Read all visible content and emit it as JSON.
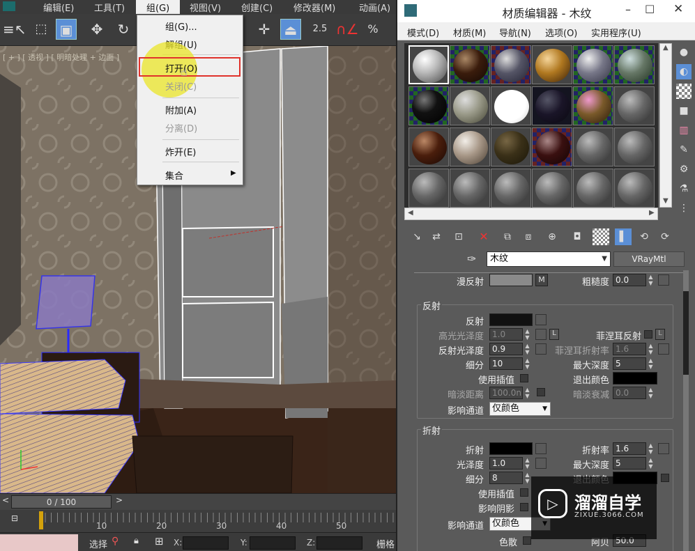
{
  "left_menu": [
    "编辑(E)",
    "工具(T)",
    "组(G)",
    "视图(V)",
    "创建(C)",
    "修改器(M)",
    "动画(A)"
  ],
  "toolbar": {
    "snap_label": "2.5",
    "percent_label": "%"
  },
  "viewport": {
    "label": "[ + ] [ 透视 ] [ 明暗处理 + 边面 ]"
  },
  "dropdown": {
    "items": [
      {
        "label": "组(G)...",
        "enabled": true
      },
      {
        "label": "解组(U)",
        "enabled": true
      },
      {
        "label": "打开(O)",
        "enabled": true,
        "highlighted": true
      },
      {
        "label": "关闭(C)",
        "enabled": false
      },
      {
        "label": "附加(A)",
        "enabled": true
      },
      {
        "label": "分离(D)",
        "enabled": false
      },
      {
        "label": "炸开(E)",
        "enabled": true
      },
      {
        "label": "集合",
        "enabled": true,
        "submenu": true
      }
    ]
  },
  "timeline": {
    "frame": "0 / 100",
    "ticks": [
      "10",
      "20",
      "30",
      "40",
      "50"
    ]
  },
  "statusbar": {
    "select_label": "选择",
    "x_label": "X:",
    "y_label": "Y:",
    "z_label": "Z:",
    "grid_label": "栅格"
  },
  "material_editor": {
    "title": "材质编辑器 - 木纹",
    "menu": [
      "模式(D)",
      "材质(M)",
      "导航(N)",
      "选项(O)",
      "实用程序(U)"
    ],
    "material_name": "木纹",
    "material_type": "VRayMtl",
    "diffuse": {
      "label": "漫反射",
      "map_btn": "M",
      "roughness_label": "粗糙度",
      "roughness": "0.0"
    },
    "reflection": {
      "group_title": "反射",
      "reflect_label": "反射",
      "hilight_gloss_label": "高光光泽度",
      "hilight_gloss": "1.0",
      "lock_btn": "L",
      "fresnel_label": "菲涅耳反射",
      "fresnel_lock": "L",
      "refl_gloss_label": "反射光泽度",
      "refl_gloss": "0.9",
      "fresnel_ior_label": "菲涅耳折射率",
      "fresnel_ior": "1.6",
      "subdivs_label": "细分",
      "subdivs": "10",
      "max_depth_label": "最大深度",
      "max_depth": "5",
      "use_interp_label": "使用插值",
      "exit_color_label": "退出颜色",
      "dim_dist_label": "暗淡距离",
      "dim_dist": "100.0n",
      "dim_falloff_label": "暗淡衰减",
      "dim_falloff": "0.0",
      "affect_channels_label": "影响通道",
      "affect_channels": "仅颜色"
    },
    "refraction": {
      "group_title": "折射",
      "refract_label": "折射",
      "ior_label": "折射率",
      "ior": "1.6",
      "gloss_label": "光泽度",
      "gloss": "1.0",
      "max_depth_label": "最大深度",
      "max_depth": "5",
      "subdivs_label": "细分",
      "subdivs": "8",
      "exit_color_label": "退出颜色",
      "use_interp_label": "使用插值",
      "affect_shadows_label": "影响阴影",
      "affect_channels_label": "影响通道",
      "affect_channels": "仅颜色",
      "dispersion_label": "色散",
      "abbe_label": "阿贝",
      "abbe": "50.0"
    }
  },
  "watermark": {
    "brand": "溜溜自学",
    "url": "ZIXUE.3066.COM"
  },
  "colors": {
    "highlight_border": "#e0322b",
    "wall": "#7e7466",
    "floor": "#3a2418",
    "wire_blue": "#2a2aff"
  }
}
